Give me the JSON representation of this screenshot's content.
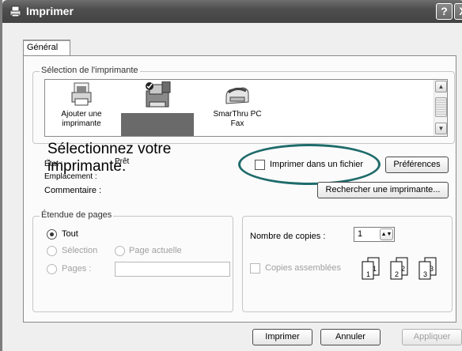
{
  "window": {
    "title": "Imprimer",
    "help_button": "?",
    "close_button": "X"
  },
  "tabs": [
    {
      "label": "Général"
    }
  ],
  "printer_selection": {
    "group_label": "Sélection de l'imprimante",
    "items": [
      {
        "label_line1": "Ajouter une",
        "label_line2": "imprimante",
        "icon": "add-printer-icon"
      },
      {
        "label_line1": "",
        "label_line2": "",
        "icon": "default-printer-icon",
        "selected": true
      },
      {
        "label_line1": "SmarThru PC",
        "label_line2": "Fax",
        "icon": "fax-icon"
      }
    ]
  },
  "instruction_text": {
    "line1": "Sélectionnez votre",
    "line2": "imprimante."
  },
  "status": {
    "etat_label": "État :",
    "etat_value": "Prêt",
    "emplacement_label": "Emplacement :",
    "commentaire_label": "Commentaire :",
    "print_to_file_label": "Imprimer dans un fichier",
    "preferences_button": "Préférences",
    "find_printer_button": "Rechercher une imprimante..."
  },
  "page_range": {
    "group_label": "Étendue de pages",
    "all_label": "Tout",
    "selection_label": "Sélection",
    "current_page_label": "Page actuelle",
    "pages_label": "Pages :",
    "pages_value": ""
  },
  "copies": {
    "count_label": "Nombre de copies :",
    "count_value": "1",
    "collate_label": "Copies assemblées",
    "collate_icons": [
      "1",
      "1",
      "2",
      "2",
      "3",
      "3"
    ]
  },
  "footer": {
    "print_button": "Imprimer",
    "cancel_button": "Annuler",
    "apply_button": "Appliquer"
  },
  "colors": {
    "titlebar": "#4e4e4e",
    "callout": "#1f6b6b",
    "selection": "#6a6a6a"
  }
}
